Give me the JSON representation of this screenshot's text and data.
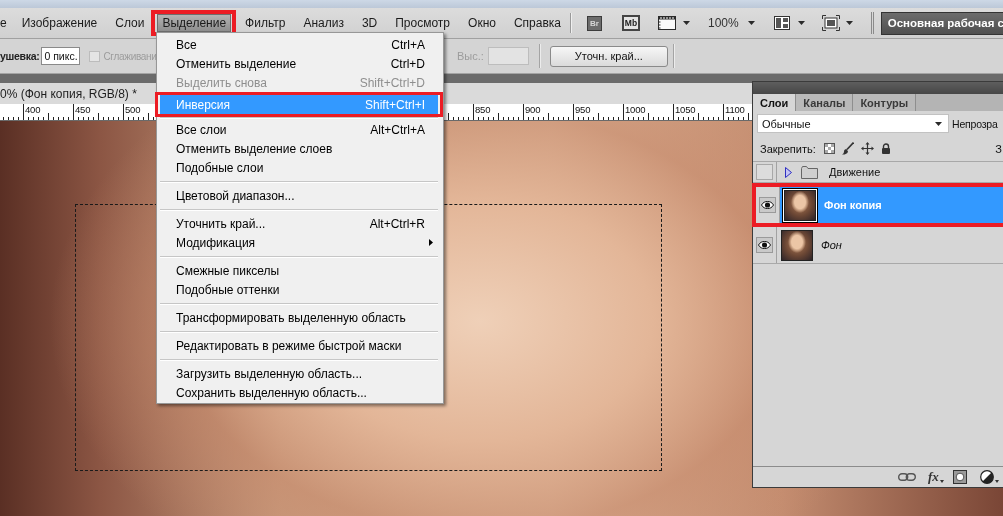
{
  "menu_bar": {
    "items": [
      {
        "label": "е",
        "selected": false,
        "marked": false
      },
      {
        "label": "Изображение",
        "selected": false,
        "marked": false
      },
      {
        "label": "Слои",
        "selected": false,
        "marked": false
      },
      {
        "label": "Выделение",
        "selected": true,
        "marked": true
      },
      {
        "label": "Фильтр",
        "selected": false,
        "marked": false
      },
      {
        "label": "Анализ",
        "selected": false,
        "marked": false
      },
      {
        "label": "3D",
        "selected": false,
        "marked": false
      },
      {
        "label": "Просмотр",
        "selected": false,
        "marked": false
      },
      {
        "label": "Окно",
        "selected": false,
        "marked": false
      },
      {
        "label": "Справка",
        "selected": false,
        "marked": false
      }
    ],
    "app_buttons": [
      {
        "label": "Br",
        "kind": "filled"
      },
      {
        "label": "Mb",
        "kind": "outlined"
      }
    ],
    "zoom": "100%",
    "workspace_button": "Основная рабочая с"
  },
  "options_bar": {
    "feather_label": "ушевка:",
    "feather_value": "0 пикс.",
    "anti_alias": {
      "label": "Сглаживани",
      "checked": false,
      "disabled": true
    },
    "height_field": {
      "label": "Выс.:",
      "disabled": true
    },
    "refine_edge_button": "Уточн. край..."
  },
  "document": {
    "tab_title": "0% (Фон копия, RGB/8) *",
    "ruler": {
      "labels_before_menu": [
        "400",
        "450",
        "500"
      ],
      "labels_after_menu": [
        "850",
        "900",
        "950",
        "1000",
        "1050",
        "1100"
      ]
    }
  },
  "menu": {
    "sections": [
      {
        "items": [
          {
            "label": "Все",
            "shortcut": "Ctrl+A",
            "disabled": false,
            "selected": false,
            "marked": false,
            "submenu": false
          },
          {
            "label": "Отменить выделение",
            "shortcut": "Ctrl+D",
            "disabled": false,
            "selected": false,
            "marked": false,
            "submenu": false
          },
          {
            "label": "Выделить снова",
            "shortcut": "Shift+Ctrl+D",
            "disabled": true,
            "selected": false,
            "marked": false,
            "submenu": false
          },
          {
            "label": "Инверсия",
            "shortcut": "Shift+Ctrl+I",
            "disabled": false,
            "selected": true,
            "marked": true,
            "submenu": false
          }
        ]
      },
      {
        "items": [
          {
            "label": "Все слои",
            "shortcut": "Alt+Ctrl+A",
            "disabled": false,
            "selected": false,
            "marked": false,
            "submenu": false
          },
          {
            "label": "Отменить выделение слоев",
            "disabled": false,
            "selected": false,
            "marked": false,
            "submenu": false
          },
          {
            "label": "Подобные слои",
            "disabled": false,
            "selected": false,
            "marked": false,
            "submenu": false
          }
        ]
      },
      {
        "items": [
          {
            "label": "Цветовой диапазон...",
            "disabled": false,
            "selected": false,
            "marked": false,
            "submenu": false
          }
        ]
      },
      {
        "items": [
          {
            "label": "Уточнить край...",
            "shortcut": "Alt+Ctrl+R",
            "disabled": false,
            "selected": false,
            "marked": false,
            "submenu": false
          },
          {
            "label": "Модификация",
            "disabled": false,
            "selected": false,
            "marked": false,
            "submenu": true
          }
        ]
      },
      {
        "items": [
          {
            "label": "Смежные пикселы",
            "disabled": false,
            "selected": false,
            "marked": false,
            "submenu": false
          },
          {
            "label": "Подобные оттенки",
            "disabled": false,
            "selected": false,
            "marked": false,
            "submenu": false
          }
        ]
      },
      {
        "items": [
          {
            "label": "Трансформировать выделенную область",
            "disabled": false,
            "selected": false,
            "marked": false,
            "submenu": false
          }
        ]
      },
      {
        "items": [
          {
            "label": "Редактировать в режиме быстрой маски",
            "disabled": false,
            "selected": false,
            "marked": false,
            "submenu": false
          }
        ]
      },
      {
        "items": [
          {
            "label": "Загрузить выделенную область...",
            "disabled": false,
            "selected": false,
            "marked": false,
            "submenu": false
          },
          {
            "label": "Сохранить выделенную область...",
            "disabled": false,
            "selected": false,
            "marked": false,
            "submenu": false
          }
        ]
      }
    ]
  },
  "layers_panel": {
    "tabs": [
      {
        "label": "Слои",
        "selected": true
      },
      {
        "label": "Каналы",
        "selected": false
      },
      {
        "label": "Контуры",
        "selected": false
      }
    ],
    "blend_mode": "Обычные",
    "opacity_label": "Непрозра",
    "lock_label": "Закрепить:",
    "fill_label": "З",
    "layers": [
      {
        "name": "Движение",
        "kind": "group",
        "expanded": false,
        "visible": false,
        "selected": false,
        "marked": false
      },
      {
        "name": "Фон копия",
        "kind": "layer",
        "visible": true,
        "selected": true,
        "marked": true
      },
      {
        "name": "Фон",
        "kind": "background",
        "visible": true,
        "selected": false,
        "marked": false
      }
    ],
    "effects_label": "fx"
  }
}
